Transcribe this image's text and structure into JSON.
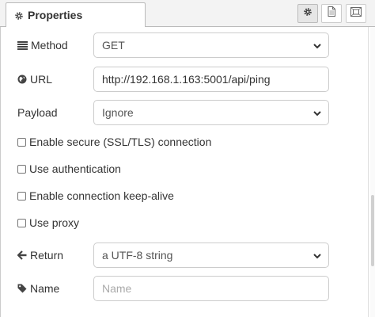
{
  "tabs": {
    "properties_label": "Properties",
    "properties_icon": "gear-icon",
    "buttons": [
      {
        "icon": "gear-icon",
        "active": true
      },
      {
        "icon": "document-icon",
        "active": false
      },
      {
        "icon": "frame-icon",
        "active": false
      }
    ]
  },
  "form": {
    "method": {
      "label": "Method",
      "icon": "list-icon",
      "value": "GET"
    },
    "url": {
      "label": "URL",
      "icon": "globe-icon",
      "value": "http://192.168.1.163:5001/api/ping"
    },
    "payload": {
      "label": "Payload",
      "value": "Ignore"
    },
    "checkboxes": [
      {
        "label": "Enable secure (SSL/TLS) connection",
        "checked": false
      },
      {
        "label": "Use authentication",
        "checked": false
      },
      {
        "label": "Enable connection keep-alive",
        "checked": false
      },
      {
        "label": "Use proxy",
        "checked": false
      }
    ],
    "return": {
      "label": "Return",
      "icon": "arrow-left-icon",
      "value": "a UTF-8 string"
    },
    "name": {
      "label": "Name",
      "icon": "tag-icon",
      "value": "",
      "placeholder": "Name"
    }
  }
}
